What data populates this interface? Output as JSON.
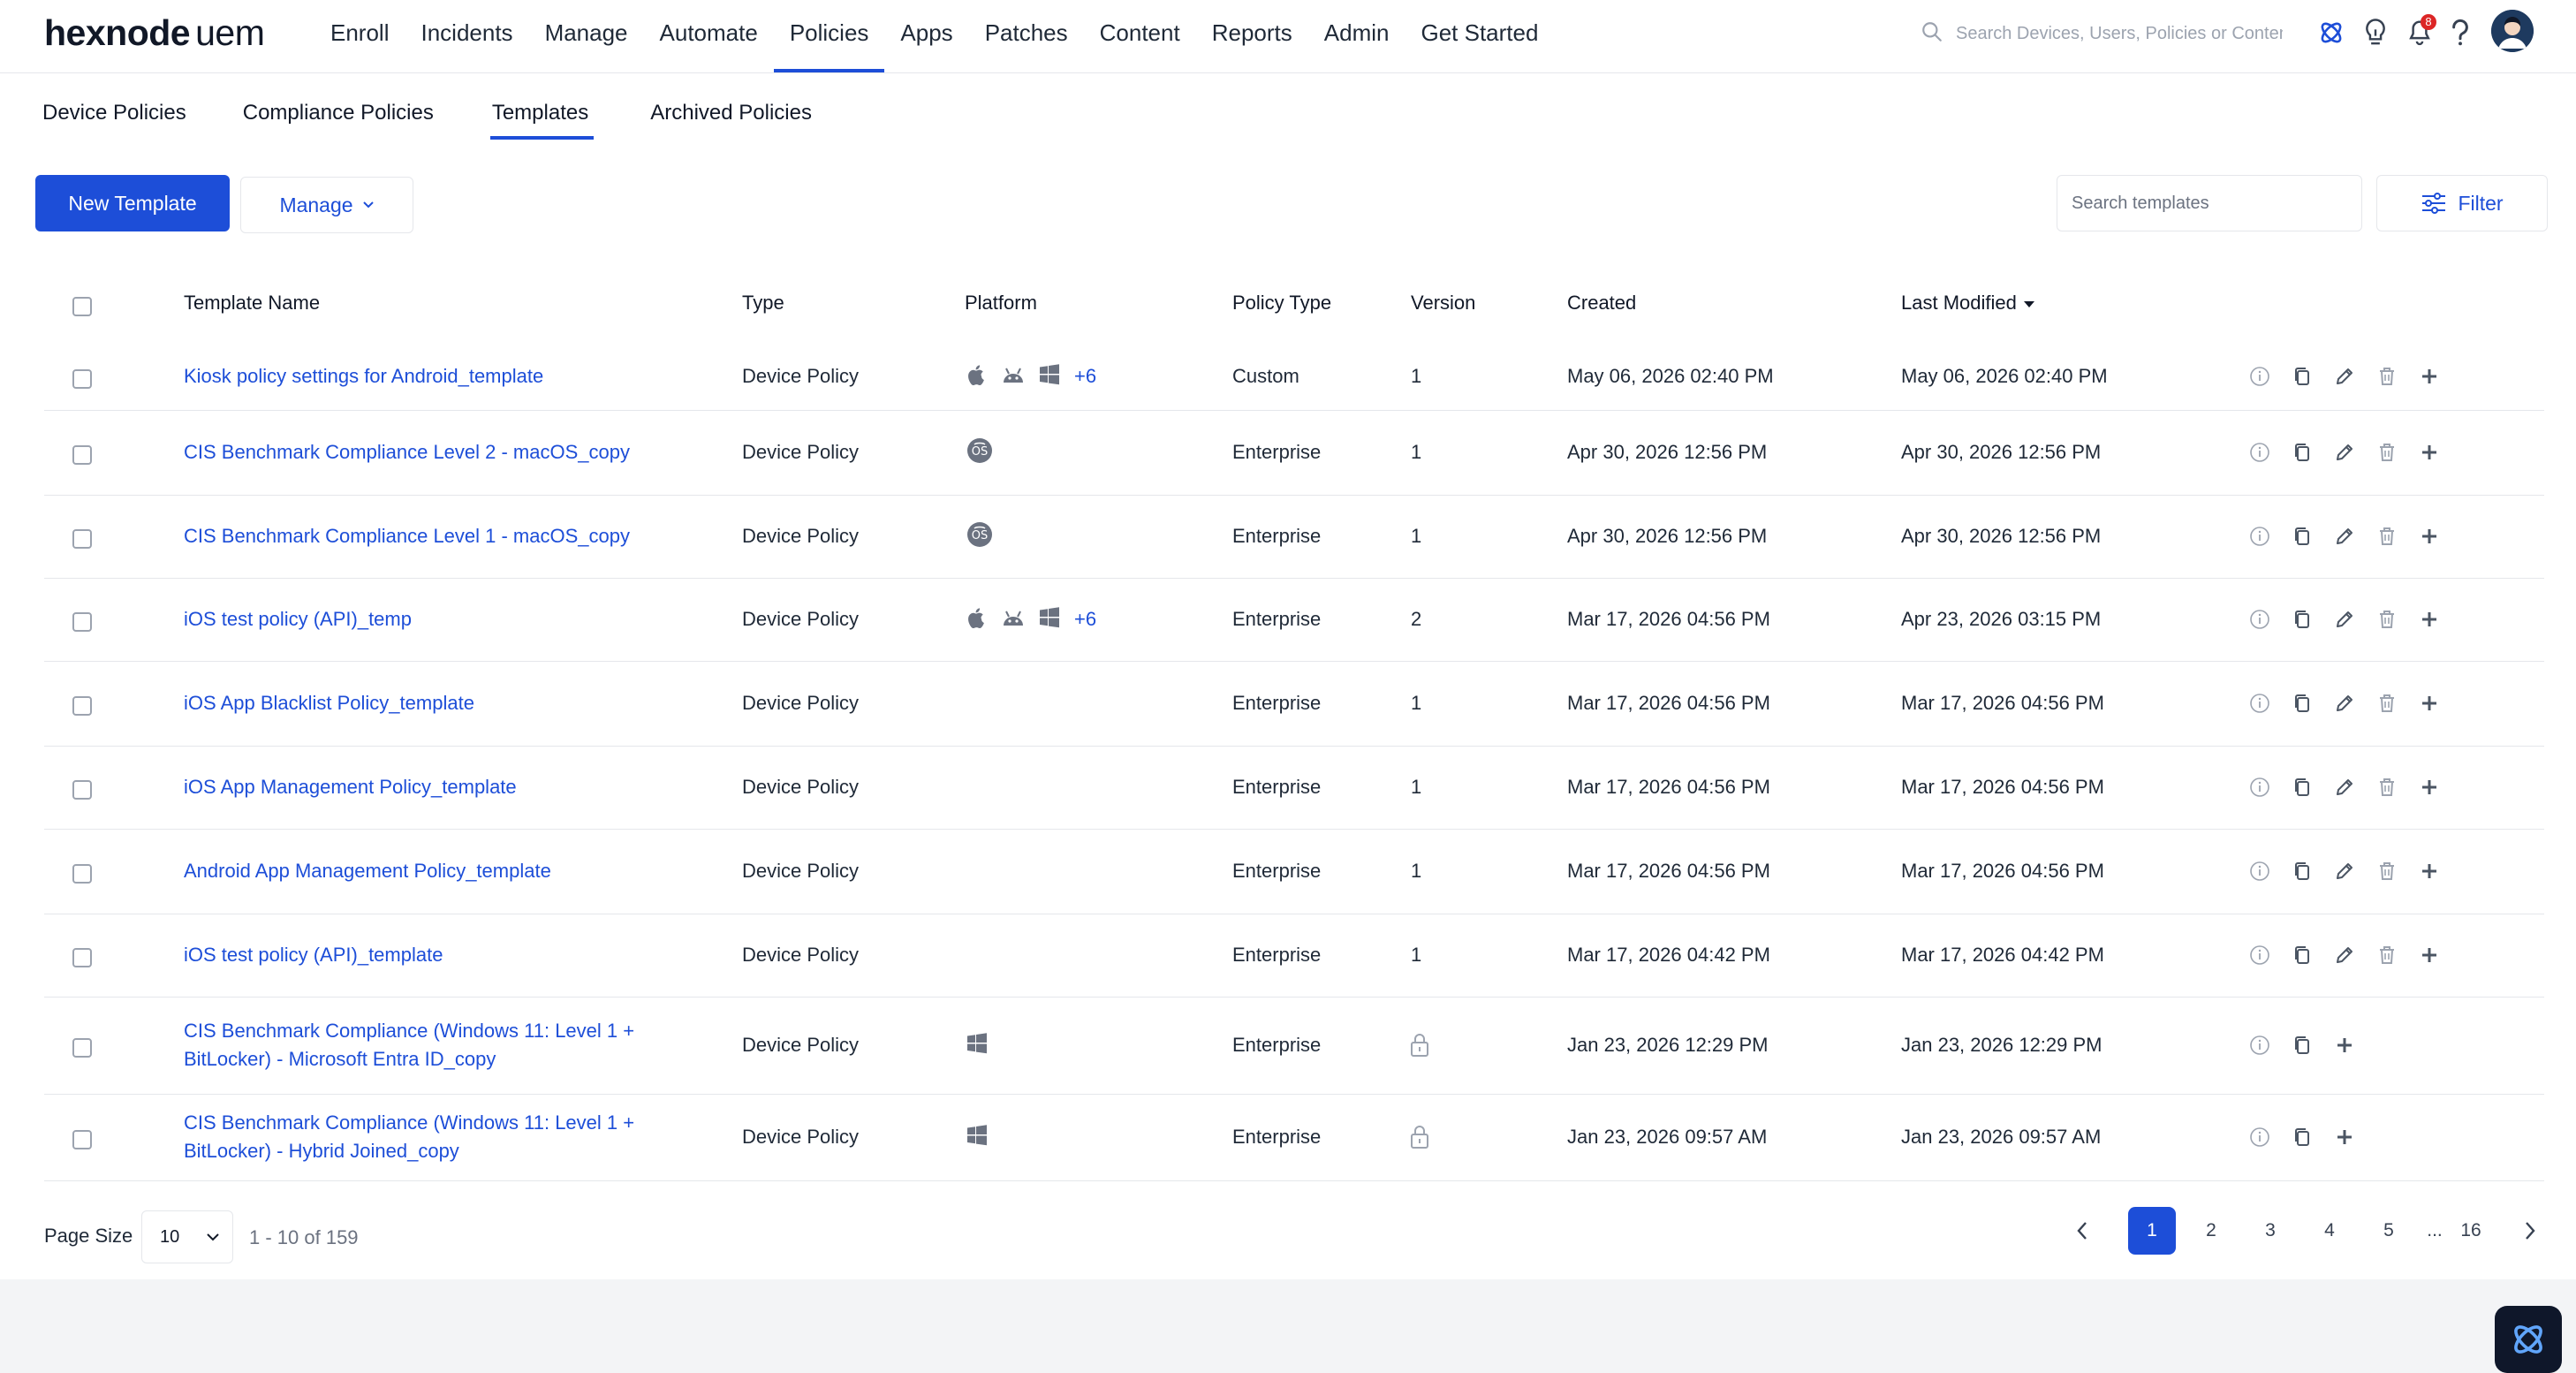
{
  "brand": {
    "name": "hexnode",
    "suffix": "uem"
  },
  "nav": [
    {
      "label": "Enroll",
      "active": false
    },
    {
      "label": "Incidents",
      "active": false
    },
    {
      "label": "Manage",
      "active": false
    },
    {
      "label": "Automate",
      "active": false
    },
    {
      "label": "Policies",
      "active": true
    },
    {
      "label": "Apps",
      "active": false
    },
    {
      "label": "Patches",
      "active": false
    },
    {
      "label": "Content",
      "active": false
    },
    {
      "label": "Reports",
      "active": false
    },
    {
      "label": "Admin",
      "active": false
    },
    {
      "label": "Get Started",
      "active": false
    }
  ],
  "global_search": {
    "placeholder": "Search Devices, Users, Policies or Content",
    "icon": "search-icon"
  },
  "header_icons": {
    "notification_count": "8"
  },
  "subtabs": [
    {
      "label": "Device Policies",
      "active": false
    },
    {
      "label": "Compliance Policies",
      "active": false
    },
    {
      "label": "Templates",
      "active": true
    },
    {
      "label": "Archived Policies",
      "active": false
    }
  ],
  "toolbar": {
    "new_label": "New Template",
    "manage_label": "Manage",
    "search_placeholder": "Search templates",
    "filter_label": "Filter"
  },
  "table": {
    "headers": {
      "name": "Template Name",
      "type": "Type",
      "platform": "Platform",
      "policy_type": "Policy Type",
      "version": "Version",
      "created": "Created",
      "modified": "Last Modified"
    },
    "sorted_by": "Last Modified",
    "rows": [
      {
        "name": "Kiosk policy settings for Android_template",
        "type": "Device Policy",
        "platforms": [
          "apple",
          "android",
          "windows"
        ],
        "more": "+6",
        "policy_type": "Custom",
        "version": "1",
        "created": "May 06, 2026 02:40 PM",
        "modified": "May 06, 2026 02:40 PM",
        "actions": [
          "info",
          "copy",
          "edit",
          "delete",
          "add"
        ]
      },
      {
        "name": "CIS Benchmark Compliance Level 2 - macOS_copy",
        "type": "Device Policy",
        "platforms": [
          "macos"
        ],
        "more": "",
        "policy_type": "Enterprise",
        "version": "1",
        "created": "Apr 30, 2026 12:56 PM",
        "modified": "Apr 30, 2026 12:56 PM",
        "actions": [
          "info",
          "copy",
          "edit",
          "delete",
          "add"
        ]
      },
      {
        "name": "CIS Benchmark Compliance Level 1 - macOS_copy",
        "type": "Device Policy",
        "platforms": [
          "macos"
        ],
        "more": "",
        "policy_type": "Enterprise",
        "version": "1",
        "created": "Apr 30, 2026 12:56 PM",
        "modified": "Apr 30, 2026 12:56 PM",
        "actions": [
          "info",
          "copy",
          "edit",
          "delete",
          "add"
        ]
      },
      {
        "name": "iOS test policy (API)_temp",
        "type": "Device Policy",
        "platforms": [
          "apple",
          "android",
          "windows"
        ],
        "more": "+6",
        "policy_type": "Enterprise",
        "version": "2",
        "created": "Mar 17, 2026 04:56 PM",
        "modified": "Apr 23, 2026 03:15 PM",
        "actions": [
          "info",
          "copy",
          "edit",
          "delete",
          "add"
        ]
      },
      {
        "name": "iOS App Blacklist Policy_template",
        "type": "Device Policy",
        "platforms": [],
        "more": "",
        "policy_type": "Enterprise",
        "version": "1",
        "created": "Mar 17, 2026 04:56 PM",
        "modified": "Mar 17, 2026 04:56 PM",
        "actions": [
          "info",
          "copy",
          "edit",
          "delete",
          "add"
        ]
      },
      {
        "name": "iOS App Management Policy_template",
        "type": "Device Policy",
        "platforms": [],
        "more": "",
        "policy_type": "Enterprise",
        "version": "1",
        "created": "Mar 17, 2026 04:56 PM",
        "modified": "Mar 17, 2026 04:56 PM",
        "actions": [
          "info",
          "copy",
          "edit",
          "delete",
          "add"
        ]
      },
      {
        "name": "Android App Management Policy_template",
        "type": "Device Policy",
        "platforms": [],
        "more": "",
        "policy_type": "Enterprise",
        "version": "1",
        "created": "Mar 17, 2026 04:56 PM",
        "modified": "Mar 17, 2026 04:56 PM",
        "actions": [
          "info",
          "copy",
          "edit",
          "delete",
          "add"
        ]
      },
      {
        "name": "iOS test policy (API)_template",
        "type": "Device Policy",
        "platforms": [],
        "more": "",
        "policy_type": "Enterprise",
        "version": "1",
        "created": "Mar 17, 2026 04:42 PM",
        "modified": "Mar 17, 2026 04:42 PM",
        "actions": [
          "info",
          "copy",
          "edit",
          "delete",
          "add"
        ]
      },
      {
        "name": "CIS Benchmark Compliance (Windows 11: Level 1 + BitLocker) - Microsoft Entra ID_copy",
        "type": "Device Policy",
        "platforms": [
          "windows"
        ],
        "more": "",
        "policy_type": "Enterprise",
        "version": "lock",
        "created": "Jan 23, 2026 12:29 PM",
        "modified": "Jan 23, 2026 12:29 PM",
        "actions": [
          "info",
          "copy",
          "add"
        ]
      },
      {
        "name": "CIS Benchmark Compliance (Windows 11: Level 1 + BitLocker) - Hybrid Joined_copy",
        "type": "Device Policy",
        "platforms": [
          "windows"
        ],
        "more": "",
        "policy_type": "Enterprise",
        "version": "lock",
        "created": "Jan 23, 2026 09:57 AM",
        "modified": "Jan 23, 2026 09:57 AM",
        "actions": [
          "info",
          "copy",
          "add"
        ]
      }
    ]
  },
  "footer": {
    "page_size_label": "Page Size",
    "page_size": "10",
    "range": "1 - 10 of 159",
    "pages": [
      "1",
      "2",
      "3",
      "4",
      "5",
      "...",
      "16"
    ],
    "current_page": "1"
  },
  "colors": {
    "accent": "#1d4ed8",
    "link": "#1d4ed8",
    "danger": "#dc2626",
    "muted_icon": "#9ca3af"
  }
}
